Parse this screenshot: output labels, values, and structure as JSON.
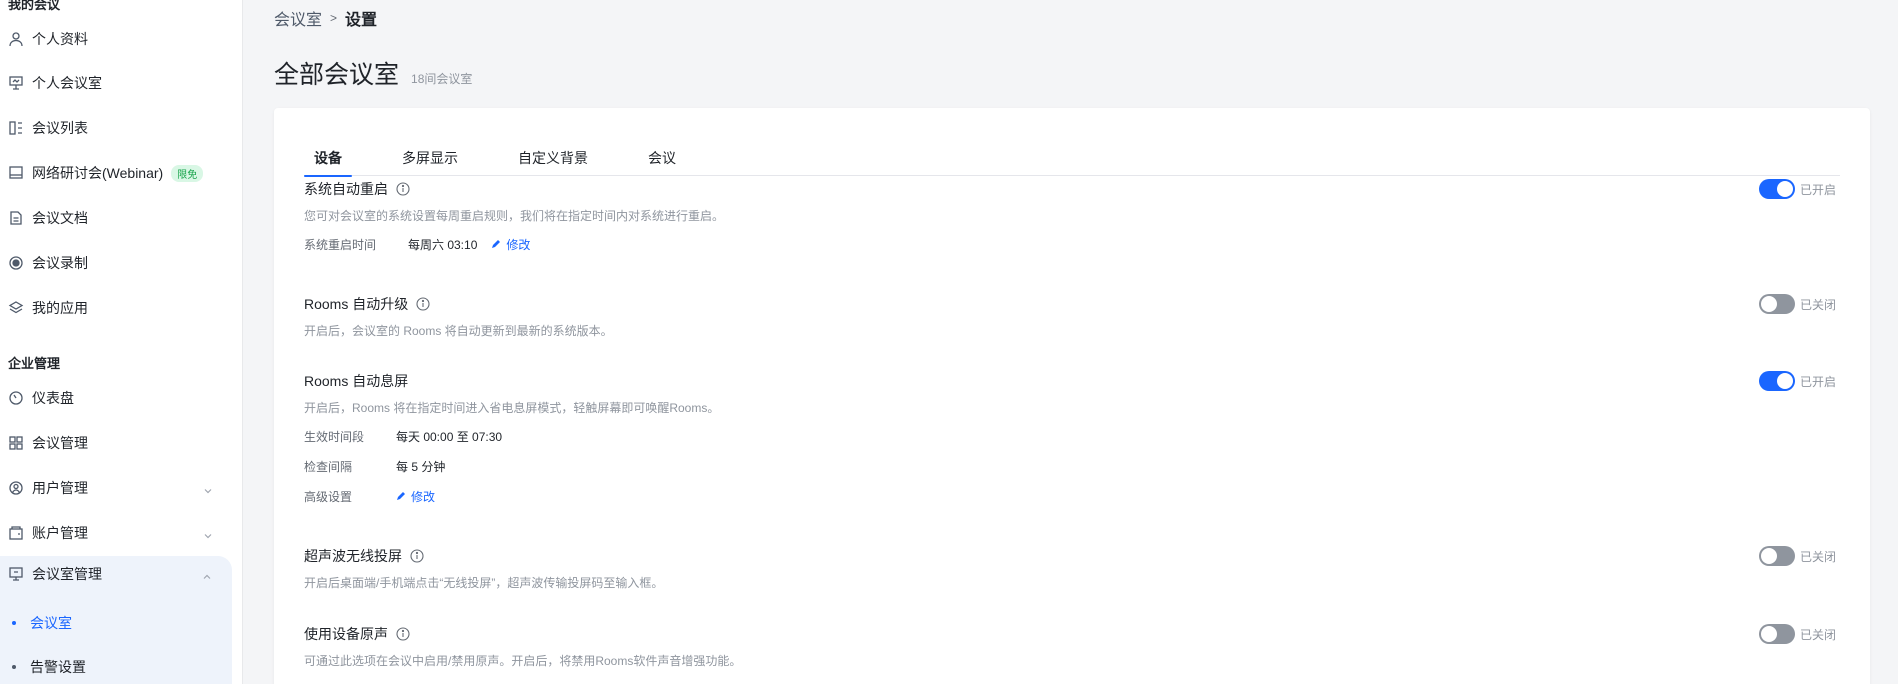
{
  "sidebar": {
    "section_my": "我的会议",
    "my_items": [
      {
        "label": "个人资料"
      },
      {
        "label": "个人会议室"
      },
      {
        "label": "会议列表"
      },
      {
        "label": "网络研讨会(Webinar)",
        "badge": "限免"
      },
      {
        "label": "会议文档"
      },
      {
        "label": "会议录制"
      },
      {
        "label": "我的应用"
      }
    ],
    "section_org": "企业管理",
    "org_items": [
      {
        "label": "仪表盘"
      },
      {
        "label": "会议管理"
      },
      {
        "label": "用户管理"
      },
      {
        "label": "账户管理"
      },
      {
        "label": "会议室管理"
      }
    ],
    "sub_items": [
      {
        "label": "会议室"
      },
      {
        "label": "告警设置"
      }
    ]
  },
  "breadcrumb": {
    "parent": "会议室",
    "separator": ">",
    "current": "设置"
  },
  "page": {
    "title": "全部会议室",
    "count": "18间会议室"
  },
  "tabs": [
    "设备",
    "多屏显示",
    "自定义背景",
    "会议"
  ],
  "settings": {
    "reboot": {
      "title": "系统自动重启",
      "desc": "您可对会议室的系统设置每周重启规则，我们将在指定时间内对系统进行重启。",
      "row_label": "系统重启时间",
      "row_value": "每周六 03:10",
      "edit": "修改",
      "state_text": "已开启"
    },
    "upgrade": {
      "title": "Rooms 自动升级",
      "desc": "开启后，会议室的 Rooms 将自动更新到最新的系统版本。",
      "state_text": "已关闭"
    },
    "sleep": {
      "title": "Rooms 自动息屏",
      "desc": "开启后，Rooms 将在指定时间进入省电息屏模式，轻触屏幕即可唤醒Rooms。",
      "period_label": "生效时间段",
      "period_value": "每天 00:00 至 07:30",
      "interval_label": "检查间隔",
      "interval_value": "每 5 分钟",
      "advanced_label": "高级设置",
      "edit": "修改",
      "state_text": "已开启"
    },
    "ultrasonic": {
      "title": "超声波无线投屏",
      "desc": "开启后桌面端/手机端点击“无线投屏”，超声波传输投屏码至输入框。",
      "state_text": "已关闭"
    },
    "original_sound": {
      "title": "使用设备原声",
      "desc": "可通过此选项在会议中启用/禁用原声。开启后，将禁用Rooms软件声音增强功能。",
      "state_text": "已关闭"
    }
  },
  "colors": {
    "accent": "#1a66ff",
    "toggle_off": "#8f959e",
    "badge_bg": "#d9f7e5",
    "badge_text": "#17a34a"
  }
}
